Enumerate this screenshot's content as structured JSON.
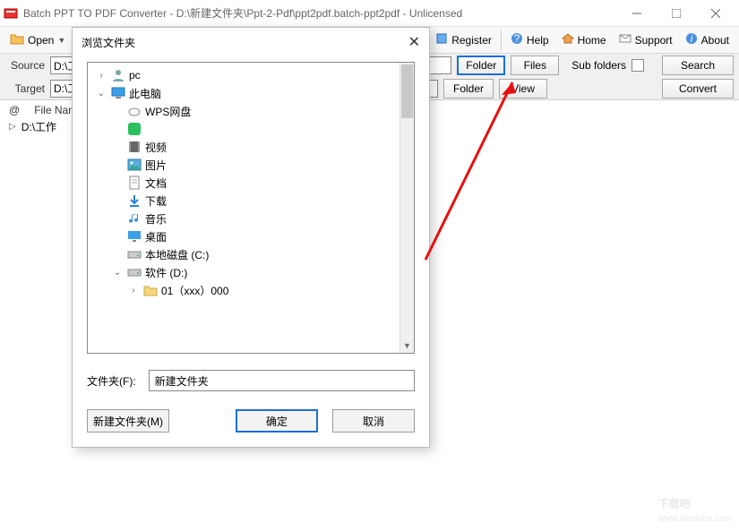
{
  "window": {
    "title": "Batch PPT TO PDF Converter - D:\\新建文件夹\\Ppt-2-Pdf\\ppt2pdf.batch-ppt2pdf - Unlicensed"
  },
  "toolbar": {
    "open": "Open",
    "register": "Register",
    "help": "Help",
    "home": "Home",
    "support": "Support",
    "about": "About"
  },
  "form": {
    "source_label": "Source",
    "source_value": "D:\\工",
    "folder_btn": "Folder",
    "files_btn": "Files",
    "subfolders_label": "Sub folders",
    "search_btn": "Search",
    "target_label": "Target",
    "target_value": "D:\\工",
    "folder_btn2": "Folder",
    "view_btn": "View",
    "convert_btn": "Convert"
  },
  "filelist": {
    "at": "@",
    "header": "File Name",
    "item0": "D:\\工作"
  },
  "dialog": {
    "title": "浏览文件夹",
    "tree": [
      {
        "depth": 0,
        "exp": ">",
        "icon": "person",
        "label": "pc"
      },
      {
        "depth": 0,
        "exp": "v",
        "icon": "monitor",
        "label": "此电脑"
      },
      {
        "depth": 1,
        "exp": "",
        "icon": "cloud",
        "label": "WPS网盘"
      },
      {
        "depth": 1,
        "exp": "",
        "icon": "green",
        "label": ""
      },
      {
        "depth": 1,
        "exp": "",
        "icon": "film",
        "label": "视频"
      },
      {
        "depth": 1,
        "exp": "",
        "icon": "pic",
        "label": "图片"
      },
      {
        "depth": 1,
        "exp": "",
        "icon": "doc",
        "label": "文档"
      },
      {
        "depth": 1,
        "exp": "",
        "icon": "down",
        "label": "下载"
      },
      {
        "depth": 1,
        "exp": "",
        "icon": "music",
        "label": "音乐"
      },
      {
        "depth": 1,
        "exp": "",
        "icon": "desktop",
        "label": "桌面"
      },
      {
        "depth": 1,
        "exp": "",
        "icon": "drive",
        "label": "本地磁盘 (C:)"
      },
      {
        "depth": 1,
        "exp": "v",
        "icon": "drive",
        "label": "软件 (D:)"
      },
      {
        "depth": 2,
        "exp": ">",
        "icon": "folder",
        "label": "01（xxx）000"
      }
    ],
    "folder_label": "文件夹(F):",
    "folder_value": "新建文件夹",
    "new_folder_btn": "新建文件夹(M)",
    "ok_btn": "确定",
    "cancel_btn": "取消"
  },
  "watermark": {
    "big": "下载吧",
    "small": "www.xiazaiba.com"
  }
}
